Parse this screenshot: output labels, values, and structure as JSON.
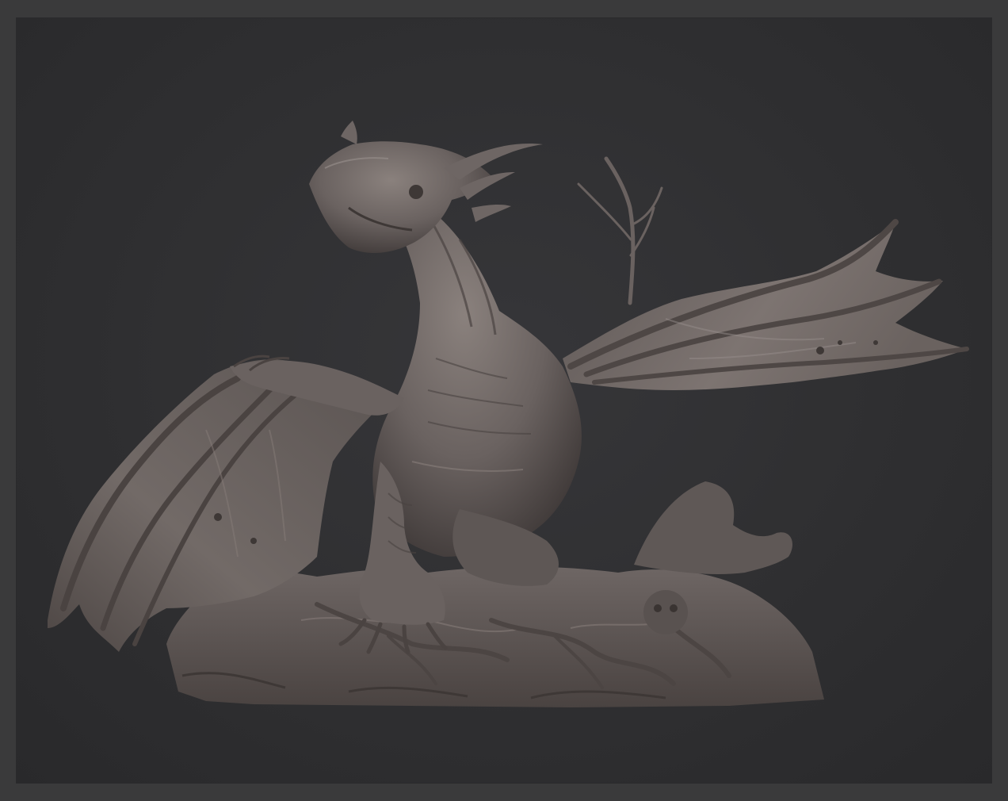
{
  "viewport": {
    "background": "#2f2f31",
    "frame_color": "#3a3a3b"
  },
  "model": {
    "material_color": "#6e6664",
    "shadow_color": "#3f3938",
    "highlight_color": "#9a918d"
  }
}
